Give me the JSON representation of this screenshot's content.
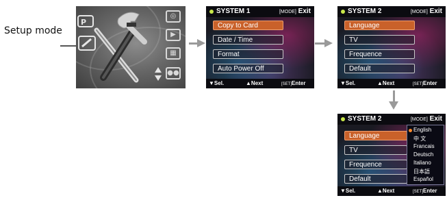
{
  "callout": {
    "label": "Setup mode"
  },
  "mode_panel": {
    "icons": [
      "setup-tools-icon",
      "camera-icon",
      "playback-icon",
      "photo-icon",
      "video-icon",
      "up-down-icon"
    ]
  },
  "colors": {
    "highlight": "#c9612a",
    "arrow": "#9a9a9a",
    "language_dot": "#ff8a2a"
  },
  "screens": [
    {
      "title": "SYSTEM 1",
      "exit_key": "[MODE]",
      "exit_label": "Exit",
      "items": [
        {
          "label": "Copy to Card",
          "selected": true
        },
        {
          "label": "Date / Time",
          "selected": false
        },
        {
          "label": "Format",
          "selected": false
        },
        {
          "label": "Auto Power Off",
          "selected": false
        }
      ],
      "footer": {
        "sel": "▼Sel.",
        "next": "▲Next",
        "enter_key": "[SET]",
        "enter_label": "Enter"
      }
    },
    {
      "title": "SYSTEM 2",
      "exit_key": "[MODE]",
      "exit_label": "Exit",
      "items": [
        {
          "label": "Language",
          "selected": true
        },
        {
          "label": "TV",
          "selected": false
        },
        {
          "label": "Frequence",
          "selected": false
        },
        {
          "label": "Default",
          "selected": false
        }
      ],
      "footer": {
        "sel": "▼Sel.",
        "next": "▲Next",
        "enter_key": "[SET]",
        "enter_label": "Enter"
      }
    },
    {
      "title": "SYSTEM 2",
      "exit_key": "[MODE]",
      "exit_label": "Exit",
      "items": [
        {
          "label": "Language",
          "selected": true
        },
        {
          "label": "TV",
          "selected": false
        },
        {
          "label": "Frequence",
          "selected": false
        },
        {
          "label": "Default",
          "selected": false
        }
      ],
      "languages": [
        {
          "label": "English",
          "selected": true
        },
        {
          "label": "中 文",
          "selected": false
        },
        {
          "label": "Francais",
          "selected": false
        },
        {
          "label": "Deutsch",
          "selected": false
        },
        {
          "label": "Italiano",
          "selected": false
        },
        {
          "label": "日本語",
          "selected": false
        },
        {
          "label": "Español",
          "selected": false
        }
      ],
      "footer": {
        "sel": "▼Sel.",
        "next": "▲Next",
        "enter_key": "[SET]",
        "enter_label": "Enter"
      }
    }
  ]
}
